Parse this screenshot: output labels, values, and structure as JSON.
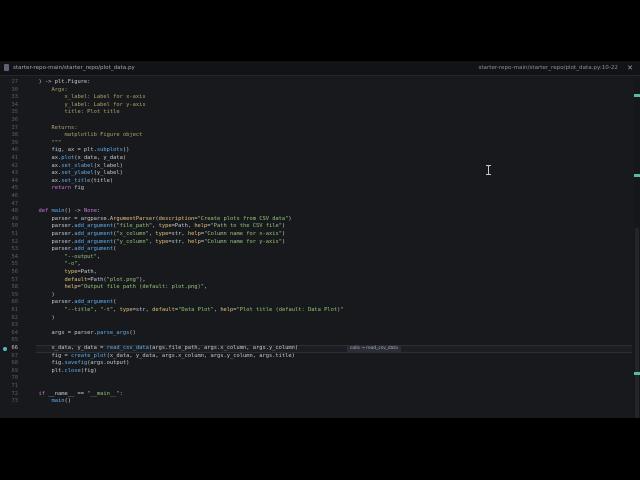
{
  "tab": {
    "title": "starter-repo-main/starter_repo/plot_data.py",
    "location": "starter-repo-main/starter_repo/plot_data.py:10-22",
    "close_glyph": "✕"
  },
  "inline_hint": "calls → read_csv_data",
  "lines": [
    {
      "num": "27",
      "segs": [
        {
          "t": ") -> plt.Figure:"
        }
      ]
    },
    {
      "num": "30",
      "segs": [
        {
          "t": "    Args:",
          "c": "com"
        }
      ]
    },
    {
      "num": "33",
      "segs": [
        {
          "t": "        x_label: Label for x-axis",
          "c": "com"
        }
      ]
    },
    {
      "num": "34",
      "segs": [
        {
          "t": "        y_label: Label for y-axis",
          "c": "com"
        }
      ]
    },
    {
      "num": "35",
      "segs": [
        {
          "t": "        title: Plot title",
          "c": "com"
        }
      ]
    },
    {
      "num": "36",
      "segs": [
        {
          "t": ""
        }
      ]
    },
    {
      "num": "37",
      "segs": [
        {
          "t": "    Returns:",
          "c": "com"
        }
      ]
    },
    {
      "num": "38",
      "segs": [
        {
          "t": "        matplotlib Figure object",
          "c": "com"
        }
      ]
    },
    {
      "num": "39",
      "segs": [
        {
          "t": "    \"\"\"",
          "c": "com"
        }
      ]
    },
    {
      "num": "40",
      "segs": [
        {
          "t": "    fig, ax = plt."
        },
        {
          "t": "subplots",
          "c": "fn"
        },
        {
          "t": "()"
        }
      ]
    },
    {
      "num": "41",
      "segs": [
        {
          "t": "    ax."
        },
        {
          "t": "plot",
          "c": "fn"
        },
        {
          "t": "(x_data, y_data)"
        }
      ]
    },
    {
      "num": "42",
      "segs": [
        {
          "t": "    ax."
        },
        {
          "t": "set_xlabel",
          "c": "fn"
        },
        {
          "t": "(x_label)"
        }
      ]
    },
    {
      "num": "43",
      "segs": [
        {
          "t": "    ax."
        },
        {
          "t": "set_ylabel",
          "c": "fn"
        },
        {
          "t": "(y_label)"
        }
      ]
    },
    {
      "num": "44",
      "segs": [
        {
          "t": "    ax."
        },
        {
          "t": "set_title",
          "c": "fn"
        },
        {
          "t": "(title)"
        }
      ]
    },
    {
      "num": "45",
      "segs": [
        {
          "t": "    "
        },
        {
          "t": "return",
          "c": "kw"
        },
        {
          "t": " fig"
        }
      ]
    },
    {
      "num": "46",
      "segs": [
        {
          "t": ""
        }
      ]
    },
    {
      "num": "47",
      "segs": [
        {
          "t": ""
        }
      ]
    },
    {
      "num": "48",
      "segs": [
        {
          "t": "def",
          "c": "kw"
        },
        {
          "t": " "
        },
        {
          "t": "main",
          "c": "fn"
        },
        {
          "t": "() -> "
        },
        {
          "t": "None",
          "c": "kw"
        },
        {
          "t": ":"
        }
      ]
    },
    {
      "num": "49",
      "segs": [
        {
          "t": "    parser = argparse."
        },
        {
          "t": "ArgumentParser",
          "c": "cls"
        },
        {
          "t": "("
        },
        {
          "t": "description",
          "c": "kwarg"
        },
        {
          "t": "="
        },
        {
          "t": "\"Create plots from CSV data\"",
          "c": "str"
        },
        {
          "t": ")"
        }
      ]
    },
    {
      "num": "50",
      "segs": [
        {
          "t": "    parser."
        },
        {
          "t": "add_argument",
          "c": "fn"
        },
        {
          "t": "("
        },
        {
          "t": "\"file_path\"",
          "c": "str"
        },
        {
          "t": ", "
        },
        {
          "t": "type",
          "c": "kwarg"
        },
        {
          "t": "=Path, "
        },
        {
          "t": "help",
          "c": "kwarg"
        },
        {
          "t": "="
        },
        {
          "t": "\"Path to the CSV file\"",
          "c": "str"
        },
        {
          "t": ")"
        }
      ]
    },
    {
      "num": "51",
      "segs": [
        {
          "t": "    parser."
        },
        {
          "t": "add_argument",
          "c": "fn"
        },
        {
          "t": "("
        },
        {
          "t": "\"x_column\"",
          "c": "str"
        },
        {
          "t": ", "
        },
        {
          "t": "type",
          "c": "kwarg"
        },
        {
          "t": "=str, "
        },
        {
          "t": "help",
          "c": "kwarg"
        },
        {
          "t": "="
        },
        {
          "t": "\"Column name for x-axis\"",
          "c": "str"
        },
        {
          "t": ")"
        }
      ]
    },
    {
      "num": "52",
      "segs": [
        {
          "t": "    parser."
        },
        {
          "t": "add_argument",
          "c": "fn"
        },
        {
          "t": "("
        },
        {
          "t": "\"y_column\"",
          "c": "str"
        },
        {
          "t": ", "
        },
        {
          "t": "type",
          "c": "kwarg"
        },
        {
          "t": "=str, "
        },
        {
          "t": "help",
          "c": "kwarg"
        },
        {
          "t": "="
        },
        {
          "t": "\"Column name for y-axis\"",
          "c": "str"
        },
        {
          "t": ")"
        }
      ]
    },
    {
      "num": "53",
      "segs": [
        {
          "t": "    parser."
        },
        {
          "t": "add_argument",
          "c": "fn"
        },
        {
          "t": "("
        }
      ]
    },
    {
      "num": "54",
      "segs": [
        {
          "t": "        "
        },
        {
          "t": "\"--output\"",
          "c": "str"
        },
        {
          "t": ","
        }
      ]
    },
    {
      "num": "55",
      "segs": [
        {
          "t": "        "
        },
        {
          "t": "\"-o\"",
          "c": "str"
        },
        {
          "t": ","
        }
      ]
    },
    {
      "num": "56",
      "segs": [
        {
          "t": "        "
        },
        {
          "t": "type",
          "c": "kwarg"
        },
        {
          "t": "=Path,"
        }
      ]
    },
    {
      "num": "57",
      "segs": [
        {
          "t": "        "
        },
        {
          "t": "default",
          "c": "kwarg"
        },
        {
          "t": "=Path("
        },
        {
          "t": "\"plot.png\"",
          "c": "str"
        },
        {
          "t": "),"
        }
      ]
    },
    {
      "num": "58",
      "segs": [
        {
          "t": "        "
        },
        {
          "t": "help",
          "c": "kwarg"
        },
        {
          "t": "="
        },
        {
          "t": "\"Output file path (default: plot.png)\"",
          "c": "str"
        },
        {
          "t": ","
        }
      ]
    },
    {
      "num": "59",
      "segs": [
        {
          "t": "    )"
        }
      ]
    },
    {
      "num": "60",
      "segs": [
        {
          "t": "    parser."
        },
        {
          "t": "add_argument",
          "c": "fn"
        },
        {
          "t": "("
        }
      ]
    },
    {
      "num": "61",
      "segs": [
        {
          "t": "        "
        },
        {
          "t": "\"--title\"",
          "c": "str"
        },
        {
          "t": ", "
        },
        {
          "t": "\"-t\"",
          "c": "str"
        },
        {
          "t": ", "
        },
        {
          "t": "type",
          "c": "kwarg"
        },
        {
          "t": "=str, "
        },
        {
          "t": "default",
          "c": "kwarg"
        },
        {
          "t": "="
        },
        {
          "t": "\"Data Plot\"",
          "c": "str"
        },
        {
          "t": ", "
        },
        {
          "t": "help",
          "c": "kwarg"
        },
        {
          "t": "="
        },
        {
          "t": "\"Plot title (default: Data Plot)\"",
          "c": "str"
        }
      ]
    },
    {
      "num": "62",
      "segs": [
        {
          "t": "    )"
        }
      ]
    },
    {
      "num": "63",
      "segs": [
        {
          "t": ""
        }
      ]
    },
    {
      "num": "64",
      "segs": [
        {
          "t": "    args = parser."
        },
        {
          "t": "parse_args",
          "c": "fn"
        },
        {
          "t": "()"
        }
      ]
    },
    {
      "num": "65",
      "segs": [
        {
          "t": ""
        }
      ]
    },
    {
      "num": "66",
      "cur": true,
      "segs": [
        {
          "t": "    x_data, y_data = "
        },
        {
          "t": "read_csv_data",
          "c": "fn"
        },
        {
          "t": "(args.file_path, args.x_column, args.y_column)"
        }
      ]
    },
    {
      "num": "67",
      "segs": [
        {
          "t": "    fig = "
        },
        {
          "t": "create_plot",
          "c": "fn"
        },
        {
          "t": "(x_data, y_data, args.x_column, args.y_column, args.title)"
        }
      ]
    },
    {
      "num": "68",
      "segs": [
        {
          "t": "    fig."
        },
        {
          "t": "savefig",
          "c": "fn"
        },
        {
          "t": "(args.output)"
        }
      ]
    },
    {
      "num": "69",
      "segs": [
        {
          "t": "    plt."
        },
        {
          "t": "close",
          "c": "fn"
        },
        {
          "t": "(fig)"
        }
      ]
    },
    {
      "num": "70",
      "segs": [
        {
          "t": ""
        }
      ]
    },
    {
      "num": "71",
      "segs": [
        {
          "t": ""
        }
      ]
    },
    {
      "num": "72",
      "segs": [
        {
          "t": "if",
          "c": "kw"
        },
        {
          "t": " __name__ == "
        },
        {
          "t": "\"__main__\"",
          "c": "str"
        },
        {
          "t": ":"
        }
      ]
    },
    {
      "num": "73",
      "segs": [
        {
          "t": "    "
        },
        {
          "t": "main",
          "c": "fn"
        },
        {
          "t": "()"
        }
      ]
    }
  ]
}
